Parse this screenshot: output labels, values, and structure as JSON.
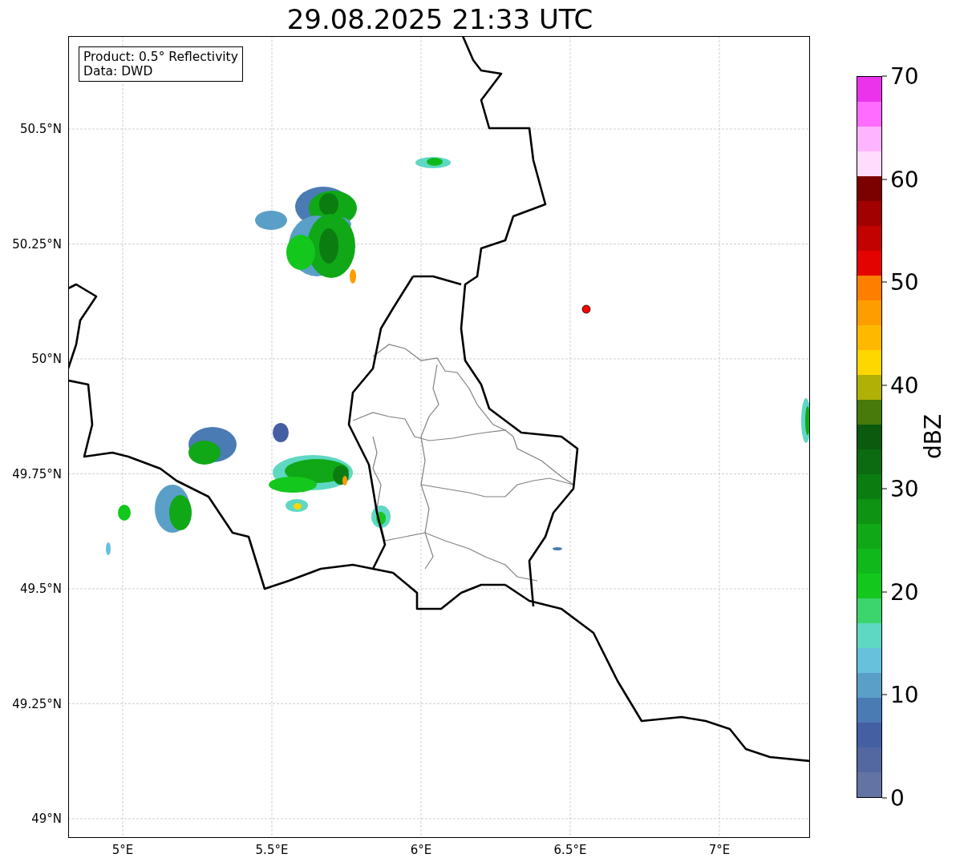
{
  "title": "29.08.2025 21:33 UTC",
  "info_box": [
    "Product: 0.5° Reflectivity",
    "Data: DWD"
  ],
  "map": {
    "xticks": [
      "5°E",
      "5.5°E",
      "6°E",
      "6.5°E",
      "7°E"
    ],
    "yticks": [
      "50.5°N",
      "50.25°N",
      "50°N",
      "49.75°N",
      "49.5°N",
      "49.25°N",
      "49°N"
    ]
  },
  "colorbar": {
    "label": "dBZ",
    "ticks": [
      "70",
      "60",
      "50",
      "40",
      "30",
      "20",
      "10",
      "0"
    ],
    "bands": [
      {
        "color": "#6373a4"
      },
      {
        "color": "#5367a0"
      },
      {
        "color": "#455fa3"
      },
      {
        "color": "#4b7bb3"
      },
      {
        "color": "#5a9fc7"
      },
      {
        "color": "#67c1dc"
      },
      {
        "color": "#5fd8c3"
      },
      {
        "color": "#3cd46c"
      },
      {
        "color": "#13c71d"
      },
      {
        "color": "#10b81c"
      },
      {
        "color": "#10a817"
      },
      {
        "color": "#0e9313"
      },
      {
        "color": "#0b7d10"
      },
      {
        "color": "#0c6a11"
      },
      {
        "color": "#0b5a0e"
      },
      {
        "color": "#477a0b"
      },
      {
        "color": "#b0b007"
      },
      {
        "color": "#fed600"
      },
      {
        "color": "#ffb800"
      },
      {
        "color": "#fe9d00"
      },
      {
        "color": "#fe7e00"
      },
      {
        "color": "#e30300"
      },
      {
        "color": "#c10200"
      },
      {
        "color": "#a10100"
      },
      {
        "color": "#7b0000"
      },
      {
        "color": "#ffdcfe"
      },
      {
        "color": "#ffb4ff"
      },
      {
        "color": "#ff6cff"
      },
      {
        "color": "#eb33eb"
      }
    ]
  }
}
